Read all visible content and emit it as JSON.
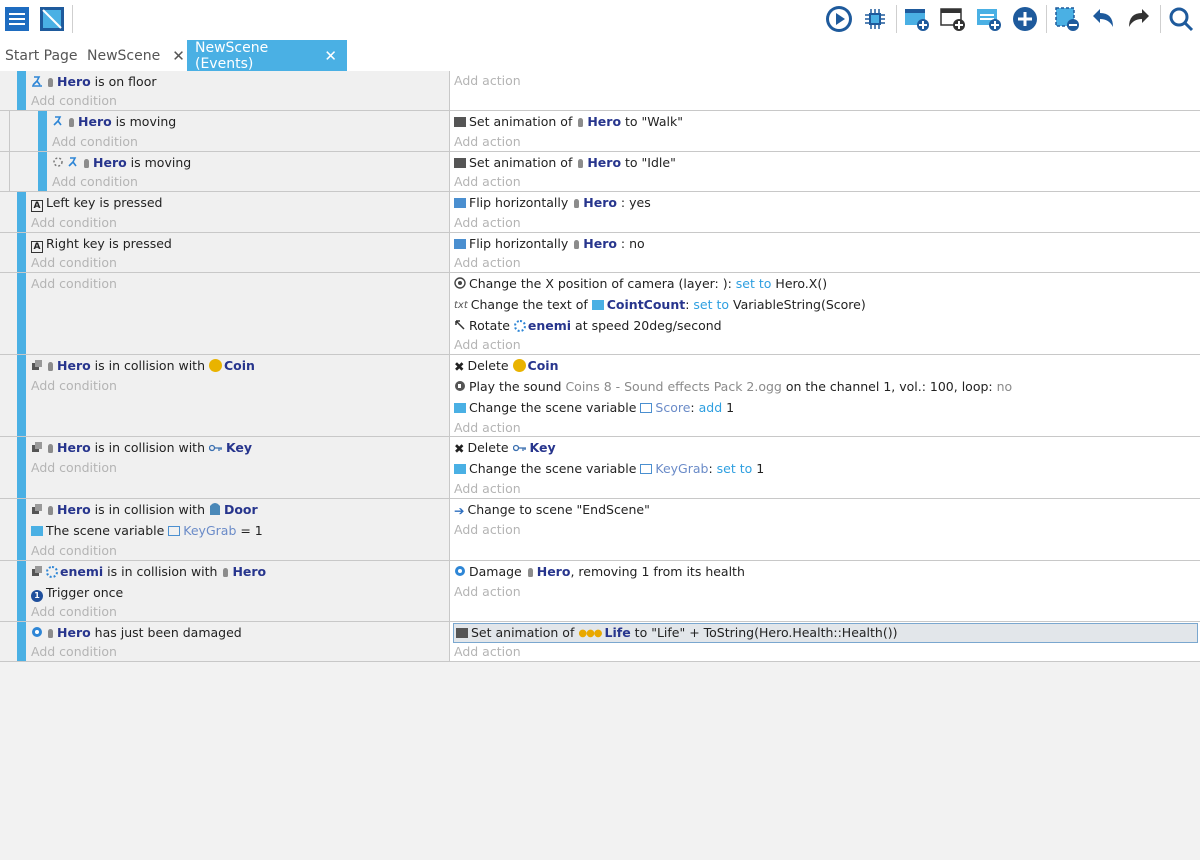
{
  "toolbar": {
    "left_icons": [
      "events-list-icon",
      "scene-editor-icon"
    ],
    "right_icons": [
      "play-icon",
      "debug-icon",
      "add-event-icon",
      "add-subevent-icon",
      "add-comment-icon",
      "add-more-icon",
      "delete-icon",
      "undo-icon",
      "redo-icon",
      "search-icon"
    ]
  },
  "tabs": [
    {
      "label": "Start Page",
      "active": false,
      "closable": false
    },
    {
      "label": "NewScene",
      "active": false,
      "closable": true
    },
    {
      "label": "NewScene (Events)",
      "active": true,
      "closable": true
    }
  ],
  "close_glyph": "✕",
  "add_condition": "Add condition",
  "add_action": "Add action",
  "events": {
    "e1": {
      "cond": {
        "object": "Hero",
        "text": " is on floor"
      }
    },
    "e2": {
      "cond": {
        "object": "Hero",
        "text": " is moving"
      },
      "act": {
        "pre": "Set animation of ",
        "object": "Hero",
        "post": " to \"Walk\""
      }
    },
    "e3": {
      "cond": {
        "object": "Hero",
        "text": " is moving"
      },
      "act": {
        "pre": "Set animation of ",
        "object": "Hero",
        "post": " to \"Idle\""
      }
    },
    "e4": {
      "cond": {
        "key": "Left",
        "text": " key is pressed"
      },
      "act": {
        "pre": "Flip horizontally ",
        "object": "Hero",
        "post": " : yes"
      }
    },
    "e5": {
      "cond": {
        "key": "Right",
        "text": " key is pressed"
      },
      "act": {
        "pre": "Flip horizontally ",
        "object": "Hero",
        "post": " : no"
      }
    },
    "e6": {
      "act1": {
        "pre": "Change the X position of camera  (layer: ): ",
        "op": "set to",
        "post": "Hero.X()"
      },
      "act2": {
        "pre": "Change the text of ",
        "object": "CointCount",
        "sep": ": ",
        "op": "set to",
        "post": "VariableString(Score)"
      },
      "act3": {
        "pre": "Rotate ",
        "object": "enemi",
        "post": " at speed 20deg/second"
      }
    },
    "e7": {
      "cond": {
        "object": "Hero",
        "mid": " is in collision with ",
        "object2": "Coin"
      },
      "act1": {
        "pre": "Delete ",
        "object": "Coin"
      },
      "act2": {
        "pre": "Play the sound ",
        "sound": "Coins 8 - Sound effects Pack 2.ogg",
        "post": " on the channel 1, vol.: 100, loop: ",
        "loop": "no"
      },
      "act3": {
        "pre": "Change the scene variable ",
        "var": "Score",
        "sep": ": ",
        "op": "add",
        "post": "1"
      }
    },
    "e8": {
      "cond": {
        "object": "Hero",
        "mid": " is in collision with ",
        "object2": "Key"
      },
      "act1": {
        "pre": "Delete ",
        "object": "Key"
      },
      "act2": {
        "pre": "Change the scene variable ",
        "var": "KeyGrab",
        "sep": ": ",
        "op": "set to",
        "post": "1"
      }
    },
    "e9": {
      "cond1": {
        "object": "Hero",
        "mid": " is in collision with ",
        "object2": "Door"
      },
      "cond2": {
        "pre": "The scene variable ",
        "var": "KeyGrab",
        "post": " = 1"
      },
      "act": {
        "pre": "Change to scene \"EndScene\""
      }
    },
    "e10": {
      "cond1": {
        "object": "enemi",
        "mid": " is in collision with ",
        "object2": "Hero"
      },
      "cond2": {
        "text": "Trigger once"
      },
      "act": {
        "pre": "Damage ",
        "object": "Hero",
        "post": ", removing 1 from its health"
      }
    },
    "e11": {
      "cond": {
        "object": "Hero",
        "text": " has just been damaged"
      },
      "act": {
        "pre": "Set animation of ",
        "object": "Life",
        "post": " to \"Life\" + ToString(Hero.Health::Health())"
      }
    }
  },
  "colors": {
    "accent": "#4ab0e4",
    "object_text": "#27358d",
    "operator_text": "#2e9fe0",
    "placeholder_text": "#b4b4b4"
  }
}
